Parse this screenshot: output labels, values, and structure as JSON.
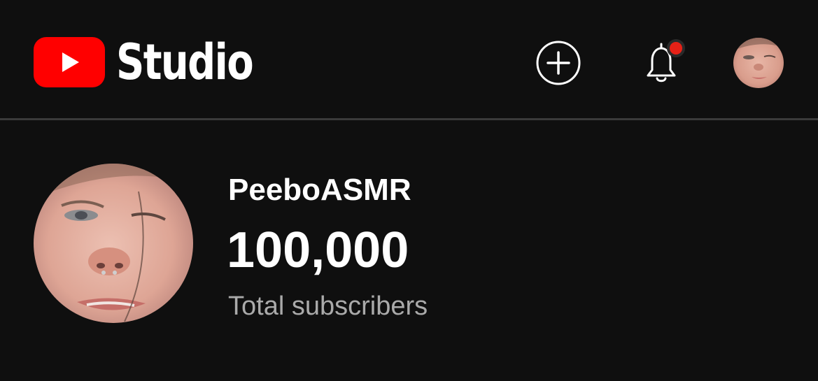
{
  "app": {
    "title": "Studio"
  },
  "header": {
    "create_icon": "plus-circle-icon",
    "notifications_icon": "bell-icon",
    "has_unread_notifications": true,
    "account_avatar": "avatar"
  },
  "channel": {
    "name": "PeeboASMR",
    "subscriber_count": "100,000",
    "subscriber_label": "Total subscribers"
  },
  "colors": {
    "background": "#0f0f0f",
    "brand_red": "#ff0000",
    "notification_dot": "#e62117",
    "divider": "#3a3a3a",
    "secondary_text": "#aaaaaa"
  }
}
